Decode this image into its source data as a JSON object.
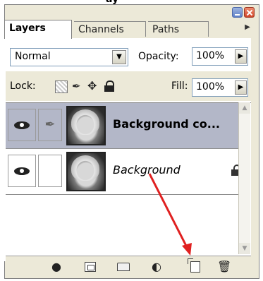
{
  "panel": {
    "header_text_partial": "ay"
  },
  "tabs": [
    {
      "label": "Layers",
      "active": true
    },
    {
      "label": "Channels",
      "active": false
    },
    {
      "label": "Paths",
      "active": false
    }
  ],
  "tab_menu_icon": "flyout-arrow-icon",
  "blend_mode": {
    "value": "Normal"
  },
  "opacity": {
    "label": "Opacity:",
    "value": "100%"
  },
  "lock": {
    "label": "Lock:"
  },
  "fill": {
    "label": "Fill:",
    "value": "100%"
  },
  "layers": [
    {
      "name": "Background co...",
      "selected": true,
      "visible": true,
      "locked": false
    },
    {
      "name": "Background",
      "selected": false,
      "visible": true,
      "locked": true
    }
  ],
  "toolbar_icons": [
    "link-layers-icon",
    "add-layer-style-icon",
    "add-layer-mask-icon",
    "new-group-icon",
    "adjustment-layer-icon",
    "new-layer-icon",
    "delete-layer-icon"
  ],
  "colors": {
    "selected_row": "#b3b7c8",
    "panel_bg": "#ece9d8",
    "arrow": "#e02020"
  }
}
